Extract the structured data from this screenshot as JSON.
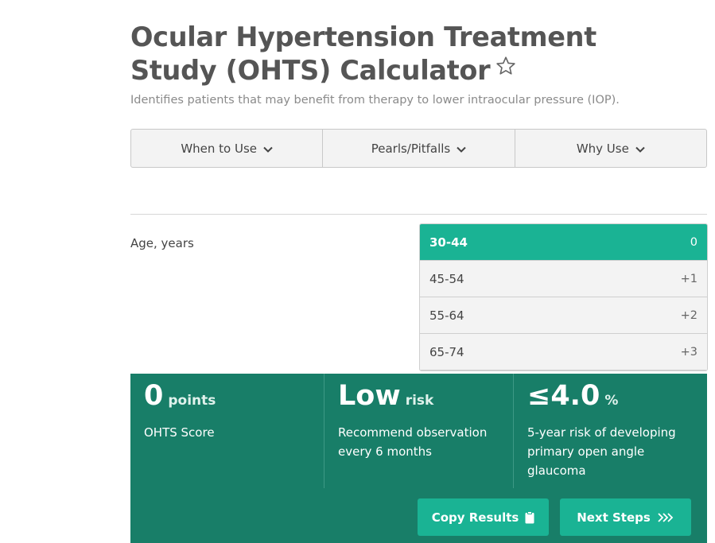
{
  "page": {
    "title": "Ocular Hypertension Treatment Study (OHTS) Calculator",
    "subtitle": "Identifies patients that may benefit from therapy to lower intraocular pressure (IOP)."
  },
  "tabs": [
    {
      "label": "When to Use"
    },
    {
      "label": "Pearls/Pitfalls"
    },
    {
      "label": "Why Use"
    }
  ],
  "question": {
    "label": "Age, years",
    "options": [
      {
        "label": "30-44",
        "points": "0",
        "selected": true
      },
      {
        "label": "45-54",
        "points": "+1"
      },
      {
        "label": "55-64",
        "points": "+2"
      },
      {
        "label": "65-74",
        "points": "+3"
      }
    ]
  },
  "result": {
    "score": {
      "value": "0",
      "unit": "points",
      "desc": "OHTS Score"
    },
    "risk": {
      "value": "Low",
      "unit": "risk",
      "desc": "Recommend observation every 6 months"
    },
    "percent": {
      "value": "≤4.0",
      "unit": "%",
      "desc": "5-year risk of developing primary open angle glaucoma"
    }
  },
  "buttons": {
    "copy": "Copy Results",
    "next": "Next Steps"
  },
  "colors": {
    "accent": "#1ab394",
    "result_bg": "#187e68"
  }
}
